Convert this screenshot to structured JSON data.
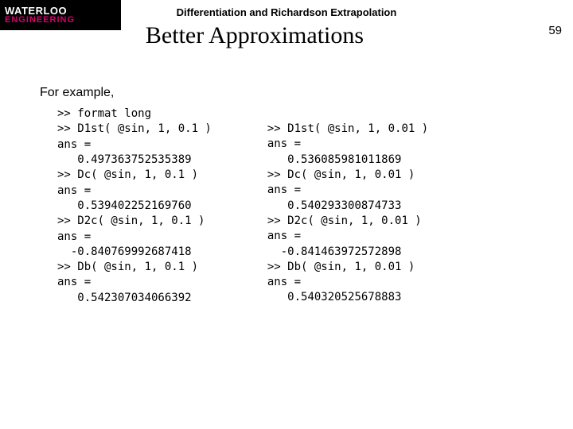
{
  "logo": {
    "line1": "WATERLOO",
    "line2": "ENGINEERING"
  },
  "header": {
    "subhead": "Differentiation and Richardson Extrapolation",
    "title": "Better Approximations",
    "page": "59"
  },
  "intro": "For example,",
  "code": {
    "left": ">> format long\n>> D1st( @sin, 1, 0.1 )\nans =\n   0.497363752535389\n>> Dc( @sin, 1, 0.1 )\nans =\n   0.539402252169760\n>> D2c( @sin, 1, 0.1 )\nans =\n  -0.840769992687418\n>> Db( @sin, 1, 0.1 )\nans =\n   0.542307034066392",
    "right": ">> D1st( @sin, 1, 0.01 )\nans =\n   0.536085981011869\n>> Dc( @sin, 1, 0.01 )\nans =\n   0.540293300874733\n>> D2c( @sin, 1, 0.01 )\nans =\n  -0.841463972572898\n>> Db( @sin, 1, 0.01 )\nans =\n   0.540320525678883"
  }
}
